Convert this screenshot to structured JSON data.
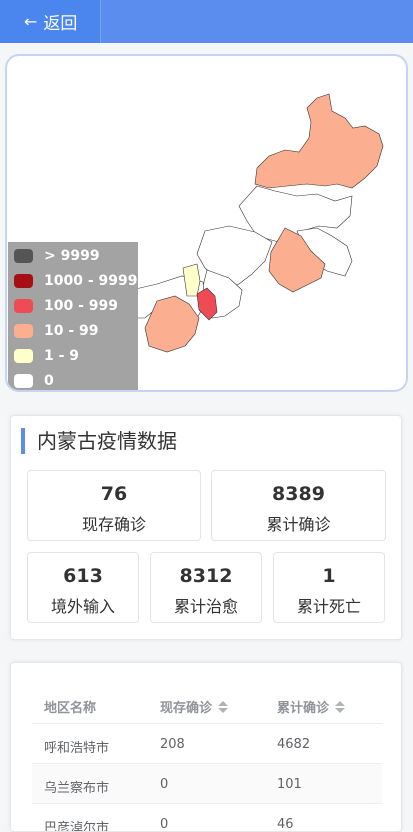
{
  "header": {
    "back_label": "返回",
    "back_icon": "arrow-left-icon"
  },
  "map": {
    "legend": [
      {
        "label": "> 9999",
        "color": "#555555"
      },
      {
        "label": "1000 - 9999",
        "color": "#a50f15"
      },
      {
        "label": "100 - 999",
        "color": "#ef4b55"
      },
      {
        "label": "10 - 99",
        "color": "#fcae91"
      },
      {
        "label": "1 - 9",
        "color": "#ffffcc"
      },
      {
        "label": "0",
        "color": "#ffffff"
      }
    ]
  },
  "stats": {
    "title": "内蒙古疫情数据",
    "items": [
      {
        "value": "76",
        "label": "现存确诊"
      },
      {
        "value": "8389",
        "label": "累计确诊"
      },
      {
        "value": "613",
        "label": "境外输入"
      },
      {
        "value": "8312",
        "label": "累计治愈"
      },
      {
        "value": "1",
        "label": "累计死亡"
      }
    ]
  },
  "table": {
    "headers": [
      "地区名称",
      "现存确诊",
      "累计确诊"
    ],
    "rows": [
      [
        "呼和浩特市",
        "208",
        "4682"
      ],
      [
        "乌兰察布市",
        "0",
        "101"
      ],
      [
        "巴彦淖尔市",
        "0",
        "46"
      ]
    ]
  }
}
